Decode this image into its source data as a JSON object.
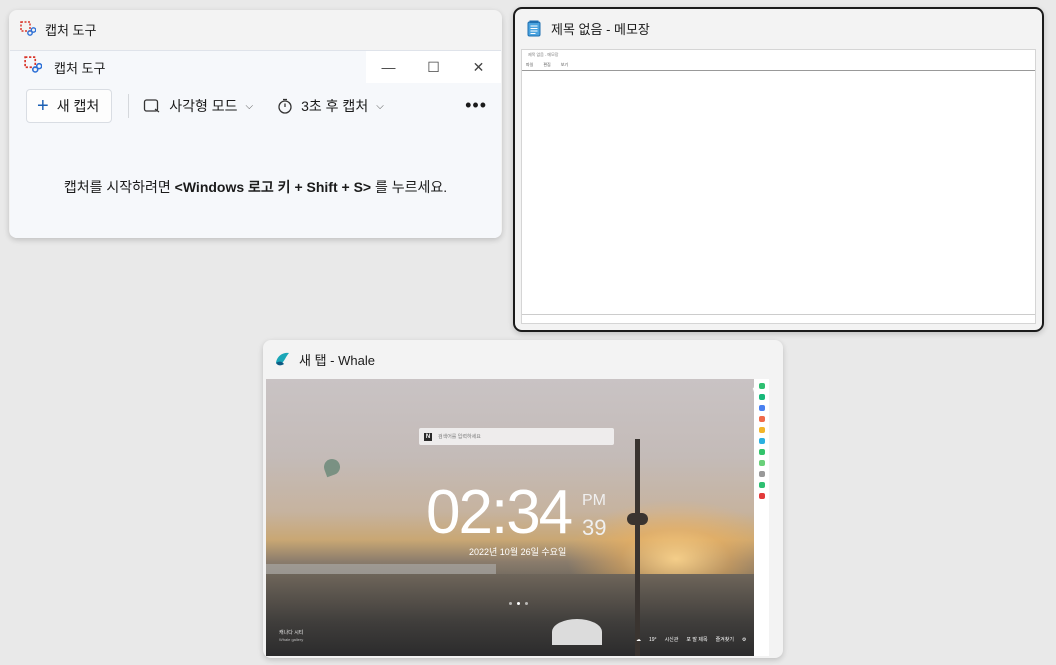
{
  "snip": {
    "outer_title": "캡처 도구",
    "app_title": "캡처 도구",
    "new_capture": "새 캡처",
    "mode": "사각형 모드",
    "delay": "3초 후 캡처",
    "more": "•••",
    "hint_pre": "캡처를 시작하려면 ",
    "hint_bold": "<Windows 로고 키 + Shift + S>",
    "hint_post": " 를 누르세요.",
    "win_min": "—",
    "win_max": "☐",
    "win_close": "✕"
  },
  "notepad": {
    "title": "제목 없음 - 메모장",
    "mini_title": "제목 없음 - 메모장",
    "menu": [
      "파일",
      "편집",
      "보기"
    ]
  },
  "whale": {
    "title": "새 탭 - Whale",
    "search_placeholder": "검색어를 입력하세요",
    "time": "02:34",
    "ampm": "PM",
    "seconds": "39",
    "date": "2022년 10월 26일 수요일",
    "bottom_left_title": "캐나다 시티",
    "bottom_left_sub": "Whale gallery",
    "weather_temp": "19°",
    "weather_items": [
      "시신관",
      "포 말 제목",
      "즐겨찾기"
    ],
    "sidebar_colors": [
      "#2fbf71",
      "#18b87a",
      "#4a80f0",
      "#f06a4a",
      "#f2b52a",
      "#2bb0e0",
      "#33c46b",
      "#6ad07a",
      "#999999",
      "#2fbf71",
      "#e23a3a"
    ]
  }
}
